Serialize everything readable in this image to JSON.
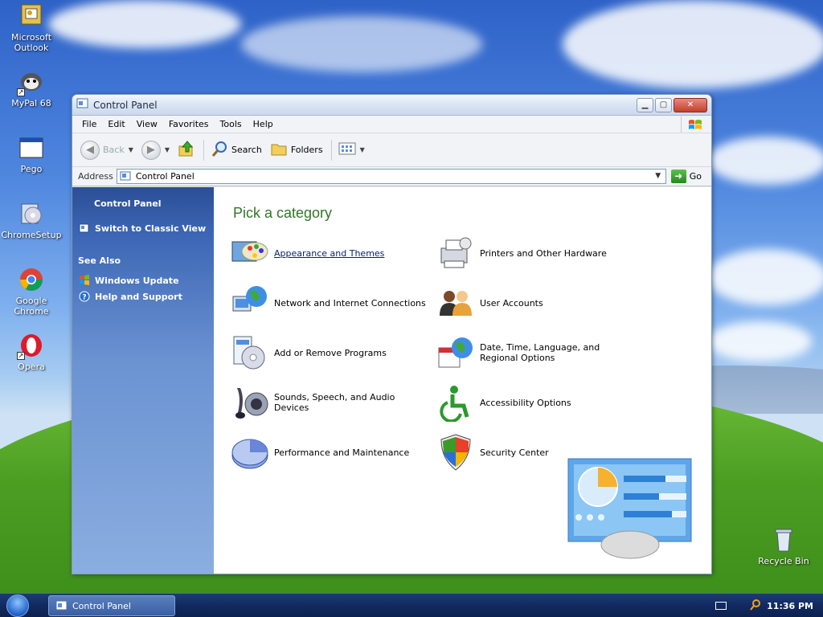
{
  "desktop": {
    "icons": [
      {
        "label": "Microsoft Outlook"
      },
      {
        "label": "MyPal 68"
      },
      {
        "label": "Pego"
      },
      {
        "label": "ChromeSetup"
      },
      {
        "label": "Google Chrome"
      },
      {
        "label": "Opera"
      },
      {
        "label": "Recycle Bin"
      }
    ]
  },
  "window": {
    "title": "Control Panel",
    "menu": [
      "File",
      "Edit",
      "View",
      "Favorites",
      "Tools",
      "Help"
    ],
    "toolbar": {
      "back": "Back",
      "search": "Search",
      "folders": "Folders"
    },
    "address": {
      "label": "Address",
      "value": "Control Panel",
      "go": "Go"
    }
  },
  "leftpane": {
    "title": "Control Panel",
    "switch_view": "Switch to Classic View",
    "see_also": "See Also",
    "links": [
      "Windows Update",
      "Help and Support"
    ]
  },
  "main": {
    "heading": "Pick a category",
    "categories": [
      {
        "label": "Appearance and Themes",
        "icon": "appearance-themes-icon"
      },
      {
        "label": "Printers and Other Hardware",
        "icon": "printer-icon"
      },
      {
        "label": "Network and Internet Connections",
        "icon": "network-globe-icon"
      },
      {
        "label": "User Accounts",
        "icon": "user-accounts-icon"
      },
      {
        "label": "Add or Remove Programs",
        "icon": "add-remove-programs-icon"
      },
      {
        "label": "Date, Time, Language, and Regional Options",
        "icon": "date-time-globe-icon"
      },
      {
        "label": "Sounds, Speech, and Audio Devices",
        "icon": "speaker-icon"
      },
      {
        "label": "Accessibility Options",
        "icon": "accessibility-icon"
      },
      {
        "label": "Performance and Maintenance",
        "icon": "performance-pie-icon"
      },
      {
        "label": "Security Center",
        "icon": "security-shield-icon"
      }
    ]
  },
  "taskbar": {
    "task": "Control Panel",
    "clock": "11:36 PM"
  },
  "colors": {
    "heading_green": "#327527",
    "left_pane_top": "#2b4e96",
    "taskbar": "#122a60"
  }
}
